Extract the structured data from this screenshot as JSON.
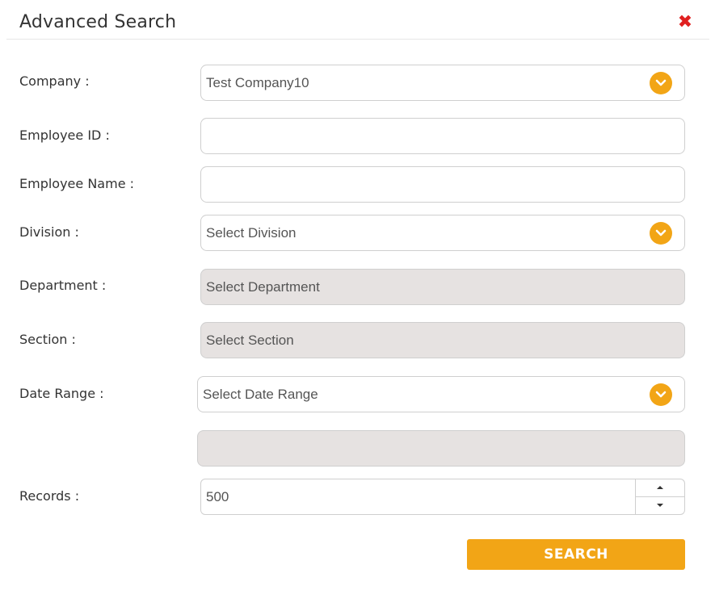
{
  "dialog": {
    "title": "Advanced Search",
    "close_icon": "close-x-icon"
  },
  "colors": {
    "accent": "#f2a516",
    "close": "#e02020",
    "disabled_field": "#e6e2e1"
  },
  "form": {
    "company": {
      "label": "Company :",
      "value": "Test Company10"
    },
    "employee_id": {
      "label": "Employee ID :",
      "value": ""
    },
    "employee_name": {
      "label": "Employee Name :",
      "value": ""
    },
    "division": {
      "label": "Division :",
      "value": "Select Division"
    },
    "department": {
      "label": "Department :",
      "value": "Select Department"
    },
    "section": {
      "label": "Section :",
      "value": "Select Section"
    },
    "date_range": {
      "label": "Date Range :",
      "value": "Select Date Range",
      "extra_value": ""
    },
    "records": {
      "label": "Records :",
      "value": "500"
    }
  },
  "search_button": {
    "label": "SEARCH"
  }
}
